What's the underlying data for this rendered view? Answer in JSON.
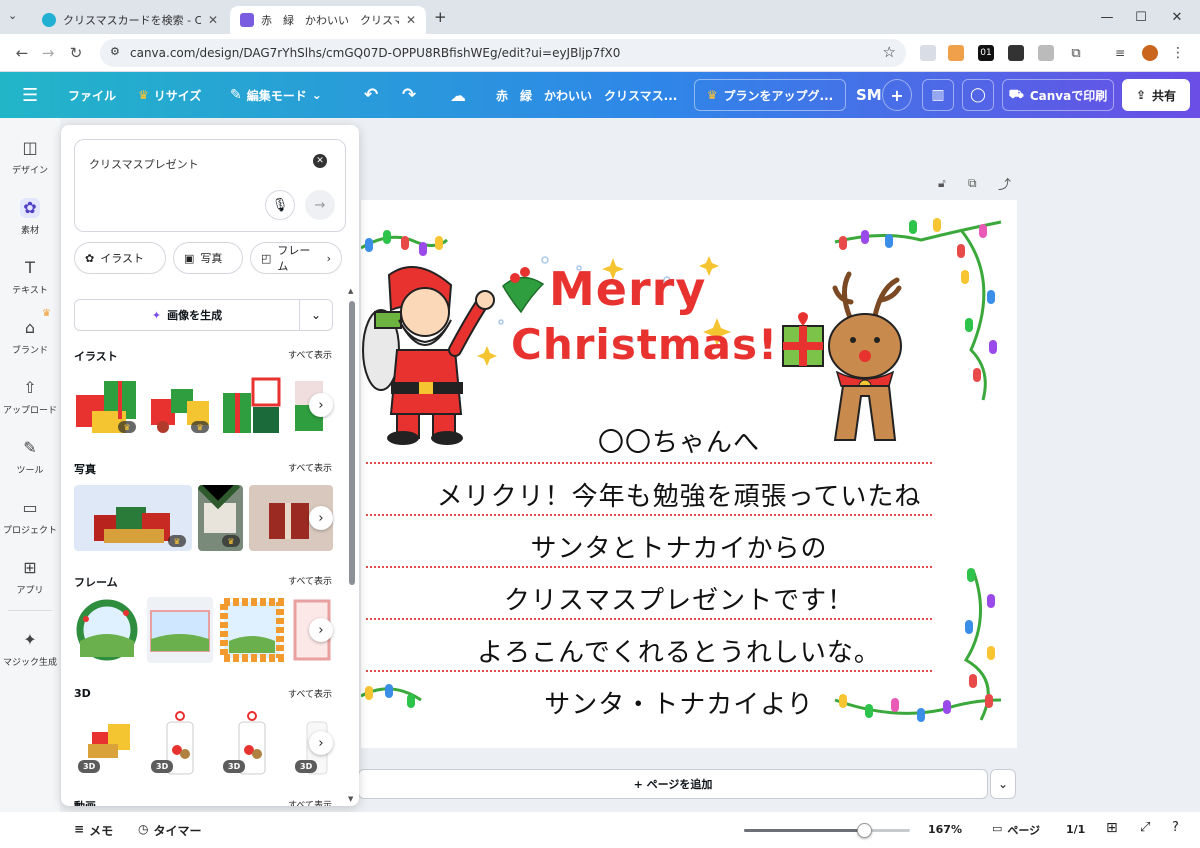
{
  "browser": {
    "tabs": [
      {
        "title": "クリスマスカードを検索 - Canva"
      },
      {
        "title": "赤　緑　かわいい　クリスマスカー"
      }
    ],
    "url": "canva.com/design/DAG7rYhSlhs/cmGQ07D-OPPU8RBfishWEg/edit?ui=eyJBljp7fX0",
    "ext_label": "01"
  },
  "header": {
    "file": "ファイル",
    "resize": "リサイズ",
    "edit_mode": "編集モード",
    "doc_title": "赤　緑　かわいい　クリスマス...",
    "upgrade": "プランをアップグ...",
    "avatar": "SM",
    "print": "Canvaで印刷",
    "share": "共有"
  },
  "rail": [
    {
      "label": "デザイン",
      "icon": "design-icon"
    },
    {
      "label": "素材",
      "icon": "elements-icon"
    },
    {
      "label": "テキスト",
      "icon": "text-icon"
    },
    {
      "label": "ブランド",
      "icon": "brand-icon"
    },
    {
      "label": "アップロード",
      "icon": "upload-icon"
    },
    {
      "label": "ツール",
      "icon": "tools-icon"
    },
    {
      "label": "プロジェクト",
      "icon": "folder-icon"
    },
    {
      "label": "アプリ",
      "icon": "apps-icon"
    },
    {
      "label": "マジック生成",
      "icon": "magic-icon"
    }
  ],
  "panel": {
    "search_value": "クリスマスプレゼント",
    "chips": [
      "イラスト",
      "写真",
      "フレーム"
    ],
    "generate": "画像を生成",
    "see_all": "すべて表示",
    "sections": {
      "illust": "イラスト",
      "photo": "写真",
      "frame": "フレーム",
      "threed": "3D",
      "video": "動画"
    },
    "badge_3d": "3D"
  },
  "card": {
    "greeting_merry": "Merry",
    "greeting_christmas": "Christmas!",
    "lines": [
      "〇〇ちゃんへ",
      "メリクリ！今年も勉強を頑張っていたね",
      "サンタとトナカイからの",
      "クリスマスプレゼントです！",
      "よろこんでくれるとうれしいな。",
      "サンタ・トナカイより"
    ]
  },
  "workspace": {
    "add_page": "+ ページを追加"
  },
  "bottom": {
    "memo": "メモ",
    "timer": "タイマー",
    "zoom": "167%",
    "zoom_fraction": 0.72,
    "page_label": "ページ",
    "page_count": "1/1"
  }
}
